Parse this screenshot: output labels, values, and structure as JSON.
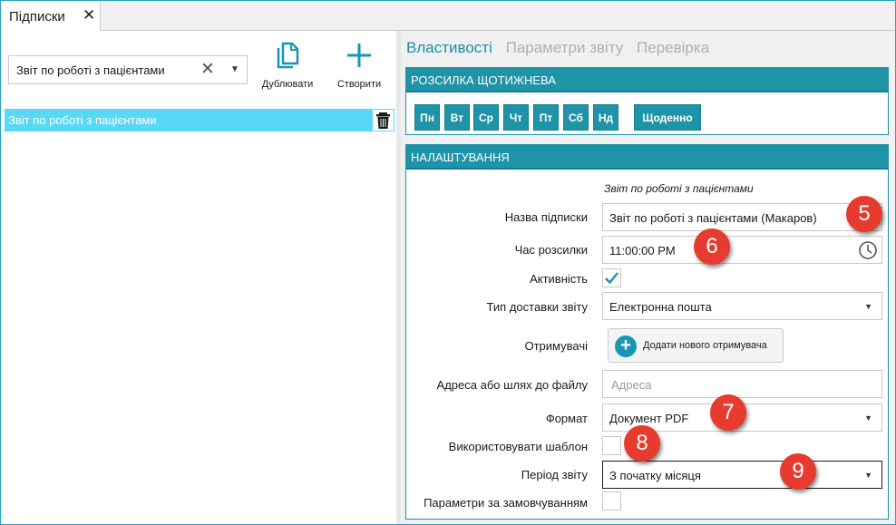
{
  "tab": {
    "title": "Підписки",
    "close_glyph": "✕"
  },
  "left": {
    "combo_value": "Звіт по роботі з пацієнтами",
    "clear_glyph": "✕",
    "duplicate_label": "Дублювати",
    "create_label": "Створити",
    "list_items": [
      {
        "label": "Звіт по роботі з пацієнтами"
      }
    ]
  },
  "right": {
    "tabs": [
      {
        "label": "Властивості",
        "active": true
      },
      {
        "label": "Параметри звіту",
        "active": false
      },
      {
        "label": "Перевірка",
        "active": false
      }
    ],
    "schedule": {
      "header": "РОЗСИЛКА ЩОТИЖНЕВА",
      "days": [
        "Пн",
        "Вт",
        "Ср",
        "Чт",
        "Пт",
        "Сб",
        "Нд"
      ],
      "daily": "Щоденно"
    },
    "settings": {
      "header": "НАЛАШТУВАННЯ",
      "subtitle": "Звіт по роботі з пацієнтами",
      "name_label": "Назва підписки",
      "name_value": "Звіт по роботі з пацієнтами (Макаров)",
      "time_label": "Час розсилки",
      "time_value": "11:00:00 PM",
      "active_label": "Активність",
      "active_checked": true,
      "delivery_label": "Тип доставки звіту",
      "delivery_value": "Електронна пошта",
      "recipients_label": "Отримувачі",
      "add_recipient": "Додати нового отримувача",
      "address_label": "Адреса або шлях до файлу",
      "address_placeholder": "Адреса",
      "format_label": "Формат",
      "format_value": "Документ PDF",
      "template_label": "Використовувати шаблон",
      "template_checked": false,
      "period_label": "Період звіту",
      "period_value": "З початку місяця",
      "defaults_label": "Параметри за замовчуванням",
      "defaults_checked": false
    }
  },
  "callouts": [
    "5",
    "6",
    "7",
    "8",
    "9"
  ],
  "colors": {
    "accent": "#1f93a8",
    "selection": "#59d8f5",
    "callout": "#e63b2e"
  }
}
